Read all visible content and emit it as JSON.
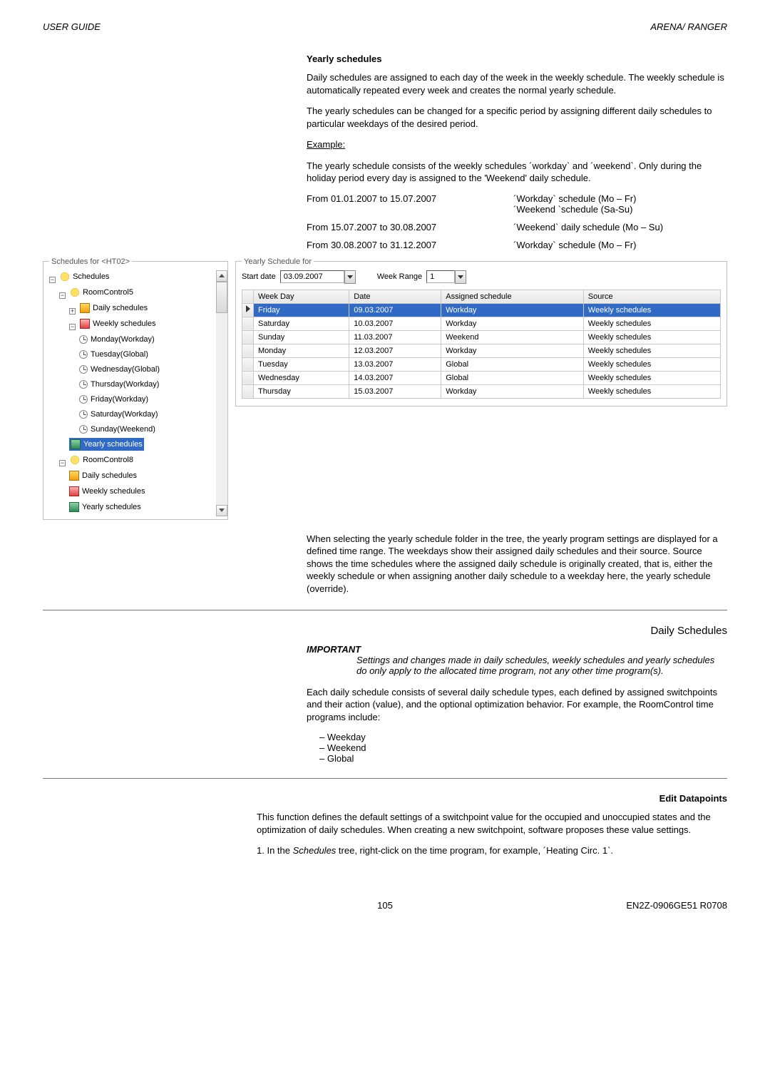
{
  "header": {
    "left": "USER GUIDE",
    "right": "ARENA/ RANGER"
  },
  "yearly": {
    "title": "Yearly schedules",
    "p1": "Daily schedules are assigned to each day of the week in the weekly schedule. The weekly schedule is automatically repeated every week and creates the normal yearly schedule.",
    "p2": "The yearly schedules can be changed for a specific period by assigning different daily schedules to particular weekdays of the desired period.",
    "example_label": "Example:",
    "p3": "The yearly schedule consists of the weekly schedules ´workday` and ´weekend`. Only during the holiday period every day is assigned to the 'Weekend' daily schedule.",
    "table1": [
      {
        "left": "From 01.01.2007 to 15.07.2007",
        "right_line1": "´Workday` schedule (Mo – Fr)",
        "right_line2": "´Weekend `schedule (Sa-Su)"
      },
      {
        "left": "From 15.07.2007 to 30.08.2007",
        "right_line1": "´Weekend` daily schedule (Mo – Su)"
      },
      {
        "left": "From 30.08.2007 to 31.12.2007",
        "right_line1": "´Workday` schedule (Mo – Fr)"
      }
    ]
  },
  "tree": {
    "fieldset_label": "Schedules for <HT02>",
    "root": "Schedules",
    "room5": "RoomControl5",
    "daily": "Daily schedules",
    "weekly": "Weekly schedules",
    "days": [
      "Monday(Workday)",
      "Tuesday(Global)",
      "Wednesday(Global)",
      "Thursday(Workday)",
      "Friday(Workday)",
      "Saturday(Workday)",
      "Sunday(Weekend)"
    ],
    "yearly_sched": "Yearly schedules",
    "room8": "RoomControl8",
    "daily2": "Daily schedules",
    "weekly2": "Weekly schedules",
    "yearly2": "Yearly schedules"
  },
  "yearly_panel": {
    "fieldset_label": "Yearly Schedule for",
    "start_date_label": "Start date",
    "start_date_value": "03.09.2007",
    "week_range_label": "Week Range",
    "week_range_value": "1",
    "columns": [
      "Week Day",
      "Date",
      "Assigned schedule",
      "Source"
    ],
    "rows": [
      {
        "weekday": "Friday",
        "date": "09.03.2007",
        "assigned": "Workday",
        "source": "Weekly schedules",
        "selected": true
      },
      {
        "weekday": "Saturday",
        "date": "10.03.2007",
        "assigned": "Workday",
        "source": "Weekly schedules"
      },
      {
        "weekday": "Sunday",
        "date": "11.03.2007",
        "assigned": "Weekend",
        "source": "Weekly schedules"
      },
      {
        "weekday": "Monday",
        "date": "12.03.2007",
        "assigned": "Workday",
        "source": "Weekly schedules"
      },
      {
        "weekday": "Tuesday",
        "date": "13.03.2007",
        "assigned": "Global",
        "source": "Weekly schedules"
      },
      {
        "weekday": "Wednesday",
        "date": "14.03.2007",
        "assigned": "Global",
        "source": "Weekly schedules"
      },
      {
        "weekday": "Thursday",
        "date": "15.03.2007",
        "assigned": "Workday",
        "source": "Weekly schedules"
      }
    ]
  },
  "after_grid": {
    "p": "When selecting the yearly schedule folder in the tree, the yearly program settings are displayed for a defined time range. The weekdays show their assigned daily schedules and their source. Source shows the time schedules where the assigned daily schedule is originally created, that is, either the weekly schedule or when assigning another daily schedule to a weekday here, the yearly schedule (override)."
  },
  "daily_section": {
    "title": "Daily Schedules",
    "important_label": "IMPORTANT",
    "important_body": "Settings and changes made in daily schedules, weekly schedules and yearly schedules do only apply to the allocated time program, not any other time program(s).",
    "p1": "Each daily schedule consists of several daily schedule types, each defined by assigned switchpoints and their action (value), and the optional optimization behavior.  For example, the RoomControl time programs include:",
    "list": [
      "Weekday",
      "Weekend",
      "Global"
    ]
  },
  "edit_dp": {
    "title": "Edit Datapoints",
    "p1": "This function defines the default settings of a switchpoint value for the occupied and unoccupied states and the optimization of daily schedules. When creating a new switchpoint, software proposes these value settings.",
    "li1_prefix": "1.   In the ",
    "li1_italic": "Schedules",
    "li1_suffix": " tree, right-click on the time program, for example, ´Heating Circ. 1`."
  },
  "footer": {
    "page": "105",
    "doc": "EN2Z-0906GE51 R0708"
  }
}
